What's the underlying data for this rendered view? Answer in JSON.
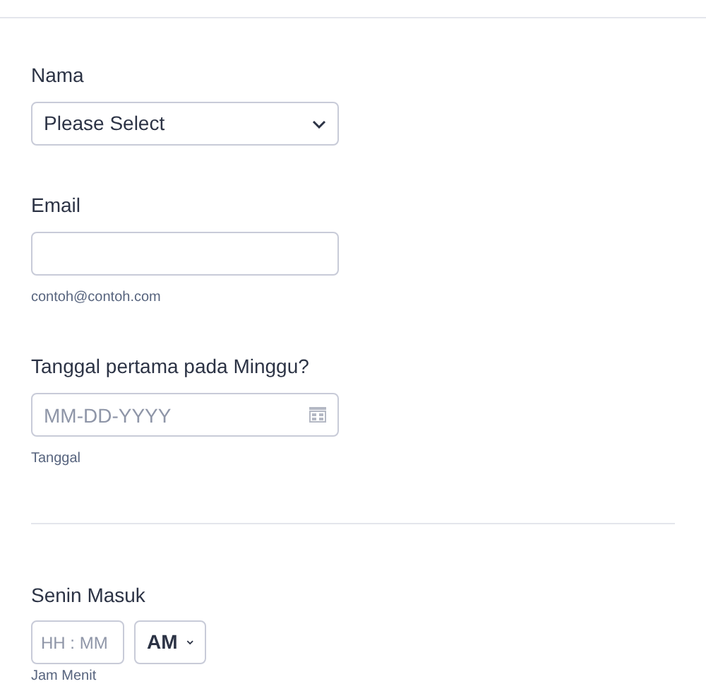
{
  "fields": [
    {
      "kind": "select",
      "label": "Nama",
      "value": "Please Select"
    },
    {
      "kind": "text",
      "label": "Email",
      "hint": "contoh@contoh.com"
    },
    {
      "kind": "date",
      "label": "Tanggal pertama pada Minggu?",
      "placeholder": "MM-DD-YYYY",
      "hint": "Tanggal"
    },
    {
      "kind": "divider"
    },
    {
      "kind": "time",
      "label": "Senin Masuk",
      "placeholder": "HH : MM",
      "period": "AM",
      "hint": "Jam Menit"
    }
  ]
}
